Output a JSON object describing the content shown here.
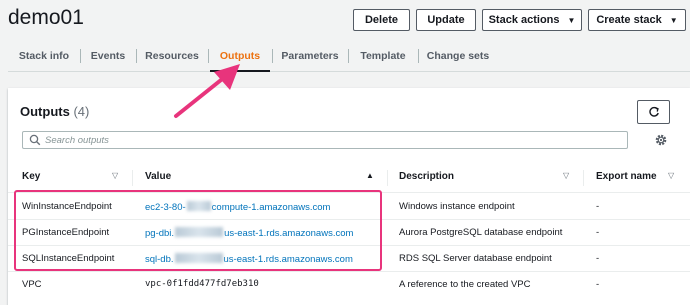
{
  "stack": {
    "title": "demo01"
  },
  "actions": {
    "delete_label": "Delete",
    "update_label": "Update",
    "stack_actions_label": "Stack actions",
    "create_stack_label": "Create stack"
  },
  "tabs": [
    {
      "label": "Stack info"
    },
    {
      "label": "Events"
    },
    {
      "label": "Resources"
    },
    {
      "label": "Outputs"
    },
    {
      "label": "Parameters"
    },
    {
      "label": "Template"
    },
    {
      "label": "Change sets"
    }
  ],
  "outputs": {
    "title": "Outputs",
    "count": "(4)",
    "search_placeholder": "Search outputs",
    "columns": {
      "key": "Key",
      "value": "Value",
      "description": "Description",
      "export_name": "Export name"
    },
    "rows": [
      {
        "key": "WinInstanceEndpoint",
        "value_prefix": "ec2-3-80-",
        "value_suffix": "compute-1.amazonaws.com",
        "description": "Windows instance endpoint",
        "export_name": "-"
      },
      {
        "key": "PGInstanceEndpoint",
        "value_prefix": "pg-dbi.",
        "value_suffix": "us-east-1.rds.amazonaws.com",
        "description": "Aurora PostgreSQL database endpoint",
        "export_name": "-"
      },
      {
        "key": "SQLInstanceEndpoint",
        "value_prefix": "sql-db.",
        "value_suffix": "us-east-1.rds.amazonaws.com",
        "description": "RDS SQL Server database endpoint",
        "export_name": "-"
      },
      {
        "key": "VPC",
        "value": "vpc-0f1fdd477fd7eb310",
        "description": "A reference to the created VPC",
        "export_name": "-"
      }
    ]
  },
  "colors": {
    "accent": "#ec7211",
    "link": "#0073bb",
    "annotation": "#e8347c"
  },
  "icons": {
    "refresh": "refresh-icon",
    "search": "search-icon",
    "settings": "gear-icon",
    "sort": "sort-caret-icon"
  }
}
